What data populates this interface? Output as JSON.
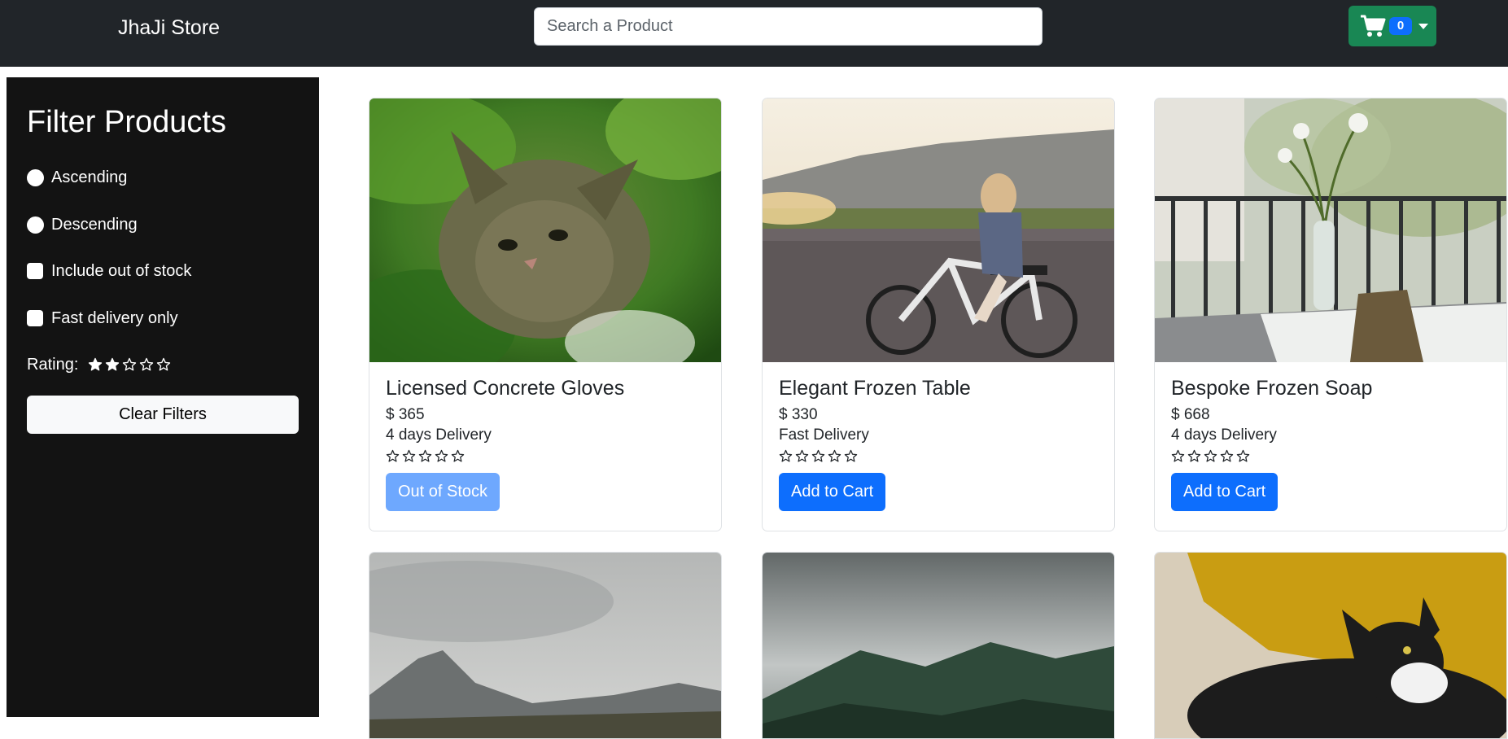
{
  "navbar": {
    "brand": "JhaJi Store",
    "search_placeholder": "Search a Product",
    "cart_count": "0"
  },
  "sidebar": {
    "title": "Filter Products",
    "options": {
      "ascending": "Ascending",
      "descending": "Descending",
      "out_of_stock": "Include out of stock",
      "fast_delivery": "Fast delivery only"
    },
    "rating_label": "Rating:",
    "rating_value": 2,
    "clear_button": "Clear Filters"
  },
  "products": [
    {
      "name": "Licensed Concrete Gloves",
      "price": "$ 365",
      "delivery": "4 days Delivery",
      "rating": 0,
      "button": "Out of Stock",
      "image": "kitten-in-leaves",
      "in_stock": false
    },
    {
      "name": "Elegant Frozen Table",
      "price": "$ 330",
      "delivery": "Fast Delivery",
      "rating": 0,
      "button": "Add to Cart",
      "image": "woman-on-bicycle",
      "in_stock": true
    },
    {
      "name": "Bespoke Frozen Soap",
      "price": "$ 668",
      "delivery": "4 days Delivery",
      "rating": 0,
      "button": "Add to Cart",
      "image": "vase-on-balcony-table",
      "in_stock": true
    },
    {
      "image": "cloudy-mountain-valley"
    },
    {
      "image": "misty-forest-hills"
    },
    {
      "image": "tuxedo-cat-on-yellow-pillow"
    }
  ],
  "colors": {
    "navbar_bg": "#212529",
    "sidebar_bg": "#131313",
    "cart_button": "#198754",
    "primary": "#0d6efd",
    "primary_disabled": "#6ea8fe"
  }
}
